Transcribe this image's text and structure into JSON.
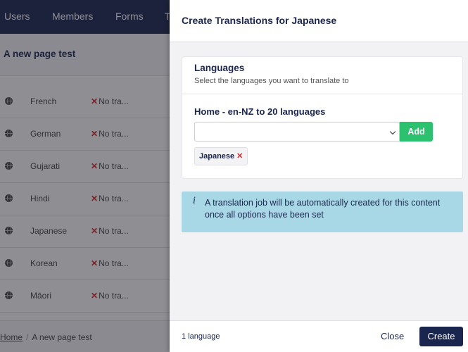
{
  "background": {
    "nav": [
      "Users",
      "Members",
      "Forms",
      "T"
    ],
    "page_title": "A new page test",
    "languages": [
      {
        "name": "French",
        "status": "No tra..."
      },
      {
        "name": "German",
        "status": "No tra..."
      },
      {
        "name": "Gujarati",
        "status": "No tra..."
      },
      {
        "name": "Hindi",
        "status": "No tra..."
      },
      {
        "name": "Japanese",
        "status": "No tra..."
      },
      {
        "name": "Korean",
        "status": "No tra..."
      },
      {
        "name": "Māori",
        "status": "No tra..."
      }
    ],
    "breadcrumb": {
      "home": "Home",
      "separator": "/",
      "current": "A new page test"
    }
  },
  "dialog": {
    "title": "Create Translations for Japanese",
    "card": {
      "title": "Languages",
      "description": "Select the languages you want to translate to",
      "section_label": "Home - en-NZ to 20 languages",
      "select_value": "",
      "add_label": "Add",
      "selected_tag": "Japanese",
      "tag_remove": "✕"
    },
    "info": {
      "icon": "i",
      "text": "A translation job will be automatically created for this content once all options have been set"
    },
    "footer": {
      "count": "1 language",
      "close_label": "Close",
      "create_label": "Create"
    }
  },
  "colors": {
    "navy": "#1b264f",
    "add_green": "#2bc16f",
    "info_blue": "#a8d8e6",
    "remove_red": "#d42c2c"
  }
}
